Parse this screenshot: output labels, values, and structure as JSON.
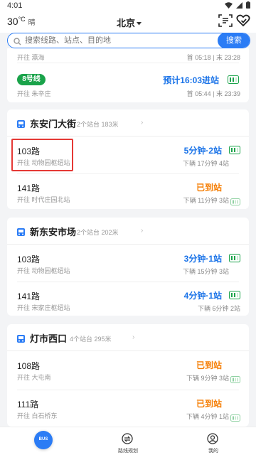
{
  "status": {
    "time": "4:01"
  },
  "header": {
    "temp": "30",
    "temp_unit": "°C",
    "weather": "晴",
    "city": "北京"
  },
  "search": {
    "placeholder": "搜索线路、站点、目的地",
    "button": "搜索"
  },
  "partial_card": {
    "dir": "开往 瀛海",
    "first_last": "首 05:18 | 末 23:28",
    "line": "8号线",
    "next": "预计16:03进站",
    "dir2": "开往 朱辛庄",
    "first_last2": "首 05:44 | 末 23:39"
  },
  "stations": [
    {
      "name": "东安门大街",
      "info": "2个站台 183米",
      "routes": [
        {
          "name": "103路",
          "dir": "开往 动物园枢纽站",
          "eta": "5分钟·2站",
          "next": "下辆 17分钟 4站",
          "arrived": false
        },
        {
          "name": "141路",
          "dir": "开往 时代庄园北站",
          "eta": "已到站",
          "next": "下辆 11分钟 3站",
          "arrived": true
        }
      ]
    },
    {
      "name": "新东安市场",
      "info": "2个站台 202米",
      "routes": [
        {
          "name": "103路",
          "dir": "开往 动物园枢纽站",
          "eta": "3分钟·1站",
          "next": "下辆 15分钟 3站",
          "arrived": false
        },
        {
          "name": "141路",
          "dir": "开往 宋家庄枢纽站",
          "eta": "4分钟·1站",
          "next": "下辆 6分钟 2站",
          "arrived": false
        }
      ]
    },
    {
      "name": "灯市西口",
      "info": "4个站台 295米",
      "routes": [
        {
          "name": "108路",
          "dir": "开往 大屯南",
          "eta": "已到站",
          "next": "下辆 9分钟 3站",
          "arrived": true
        },
        {
          "name": "111路",
          "dir": "开往 白石桥东",
          "eta": "已到站",
          "next": "下辆 4分钟 1站",
          "arrived": true
        }
      ]
    }
  ],
  "tabs": {
    "home": "BUS",
    "route_plan": "路线规划",
    "mine": "我的"
  },
  "colors": {
    "accent": "#2b7cf5",
    "arrived": "#f57c00",
    "line8": "#1aa34a",
    "highlight": "#e53935"
  },
  "icons": [
    "wifi-icon",
    "signal-icon",
    "battery-icon",
    "scan-icon",
    "heart-icon",
    "search-icon",
    "bus-icon",
    "occupancy-icon",
    "route-plan-icon",
    "user-icon"
  ]
}
